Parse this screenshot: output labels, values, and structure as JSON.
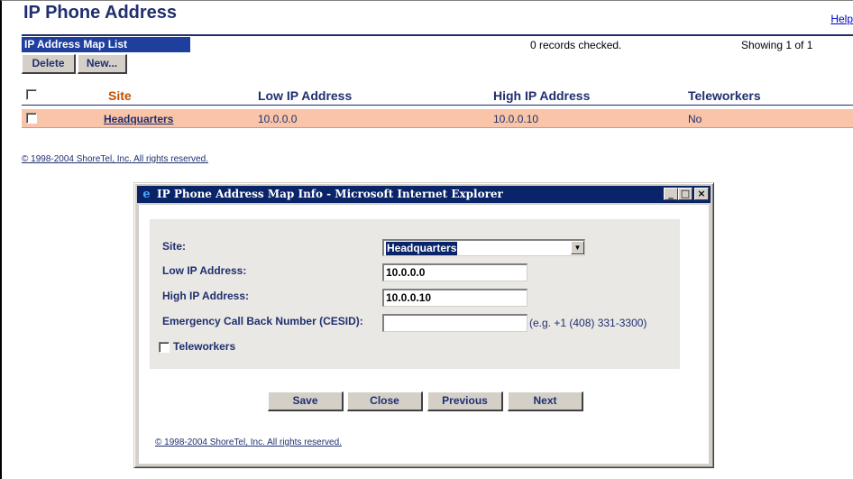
{
  "page": {
    "title": "IP Phone Address",
    "help_label": "Help",
    "list_header": "IP Address Map List",
    "records_checked": "0 records checked.",
    "showing": "Showing 1 of 1"
  },
  "toolbar": {
    "delete_label": "Delete",
    "new_label": "New..."
  },
  "table": {
    "columns": [
      "Site",
      "Low IP Address",
      "High IP Address",
      "Teleworkers"
    ],
    "rows": [
      {
        "site": "Headquarters",
        "low_ip": "10.0.0.0",
        "high_ip": "10.0.0.10",
        "teleworkers": "No"
      }
    ]
  },
  "copyright": "© 1998-2004 ShoreTel, Inc. All rights reserved.",
  "dialog": {
    "title": "IP Phone Address Map Info - Microsoft Internet Explorer",
    "controls": {
      "minimize": "_",
      "maximize": "□",
      "close": "×"
    },
    "fields": {
      "site_label": "Site:",
      "site_value": "Headquarters",
      "low_label": "Low IP Address:",
      "low_value": "10.0.0.0",
      "high_label": "High IP Address:",
      "high_value": "10.0.0.10",
      "cesid_label": "Emergency Call Back Number (CESID):",
      "cesid_value": "",
      "cesid_hint": "(e.g. +1 (408) 331-3300)",
      "teleworkers_label": "Teleworkers"
    },
    "buttons": {
      "save": "Save",
      "close": "Close",
      "previous": "Previous",
      "next": "Next"
    },
    "copyright": "© 1998-2004 ShoreTel, Inc. All rights reserved."
  },
  "colors": {
    "accent": "#1f2f6f",
    "header_bar": "#1f3f9f",
    "selected_row": "#f9c4a8",
    "site_header": "#c05000",
    "titlebar": "#0a246a"
  }
}
